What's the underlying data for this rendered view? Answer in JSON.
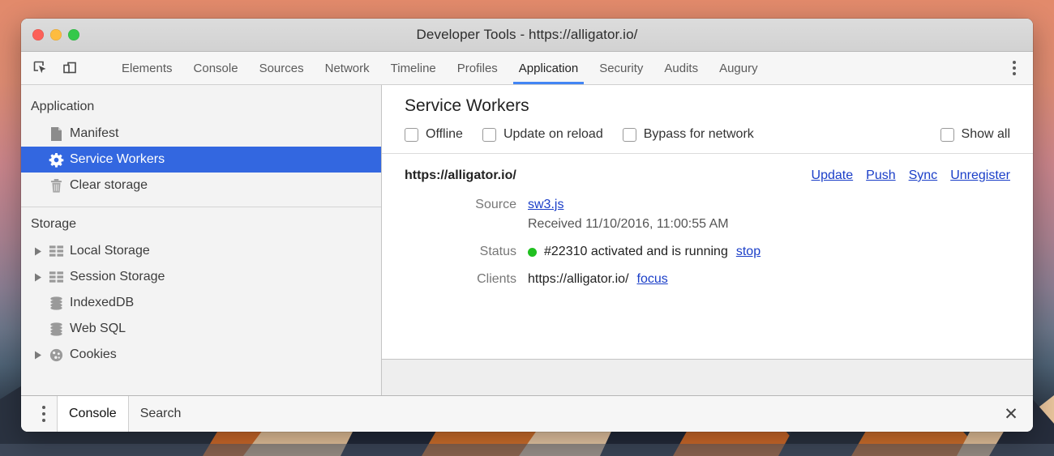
{
  "window": {
    "title": "Developer Tools - https://alligator.io/",
    "traffic_lights": [
      {
        "name": "close",
        "color": "#fc6058"
      },
      {
        "name": "minimize",
        "color": "#fdbc40"
      },
      {
        "name": "zoom",
        "color": "#34c84a"
      }
    ]
  },
  "toolbar": {
    "inspect_icon": "inspect-element-icon",
    "device_icon": "device-toolbar-icon",
    "more_icon": "more-options-icon",
    "tabs": [
      {
        "label": "Elements",
        "active": false
      },
      {
        "label": "Console",
        "active": false
      },
      {
        "label": "Sources",
        "active": false
      },
      {
        "label": "Network",
        "active": false
      },
      {
        "label": "Timeline",
        "active": false
      },
      {
        "label": "Profiles",
        "active": false
      },
      {
        "label": "Application",
        "active": true
      },
      {
        "label": "Security",
        "active": false
      },
      {
        "label": "Audits",
        "active": false
      },
      {
        "label": "Augury",
        "active": false
      }
    ]
  },
  "sidebar": {
    "sections": [
      {
        "title": "Application",
        "items": [
          {
            "label": "Manifest",
            "icon": "document-icon",
            "selected": false,
            "expandable": false
          },
          {
            "label": "Service Workers",
            "icon": "gear-icon",
            "selected": true,
            "expandable": false
          },
          {
            "label": "Clear storage",
            "icon": "trash-icon",
            "selected": false,
            "expandable": false
          }
        ]
      },
      {
        "title": "Storage",
        "items": [
          {
            "label": "Local Storage",
            "icon": "table-icon",
            "selected": false,
            "expandable": true
          },
          {
            "label": "Session Storage",
            "icon": "table-icon",
            "selected": false,
            "expandable": true
          },
          {
            "label": "IndexedDB",
            "icon": "database-icon",
            "selected": false,
            "expandable": false
          },
          {
            "label": "Web SQL",
            "icon": "database-icon",
            "selected": false,
            "expandable": false
          },
          {
            "label": "Cookies",
            "icon": "cookie-icon",
            "selected": false,
            "expandable": true
          }
        ]
      }
    ]
  },
  "main": {
    "title": "Service Workers",
    "options": [
      {
        "label": "Offline",
        "checked": false
      },
      {
        "label": "Update on reload",
        "checked": false
      },
      {
        "label": "Bypass for network",
        "checked": false
      }
    ],
    "show_all": {
      "label": "Show all",
      "checked": false
    },
    "worker": {
      "origin": "https://alligator.io/",
      "actions": [
        "Update",
        "Push",
        "Sync",
        "Unregister"
      ],
      "source_label": "Source",
      "source_file": "sw3.js",
      "received": "Received 11/10/2016, 11:00:55 AM",
      "status_label": "Status",
      "status_text": "#22310 activated and is running",
      "status_color": "#20c020",
      "status_action": "stop",
      "clients_label": "Clients",
      "clients_value": "https://alligator.io/",
      "clients_action": "focus"
    }
  },
  "drawer": {
    "more_icon": "more-options-icon",
    "tabs": [
      {
        "label": "Console",
        "active": true
      },
      {
        "label": "Search",
        "active": false
      }
    ],
    "close_label": "✕"
  },
  "colors": {
    "accent_blue": "#4285f4",
    "selection_blue": "#3367e0",
    "link_blue": "#1a3ec8",
    "status_green": "#20c020"
  }
}
